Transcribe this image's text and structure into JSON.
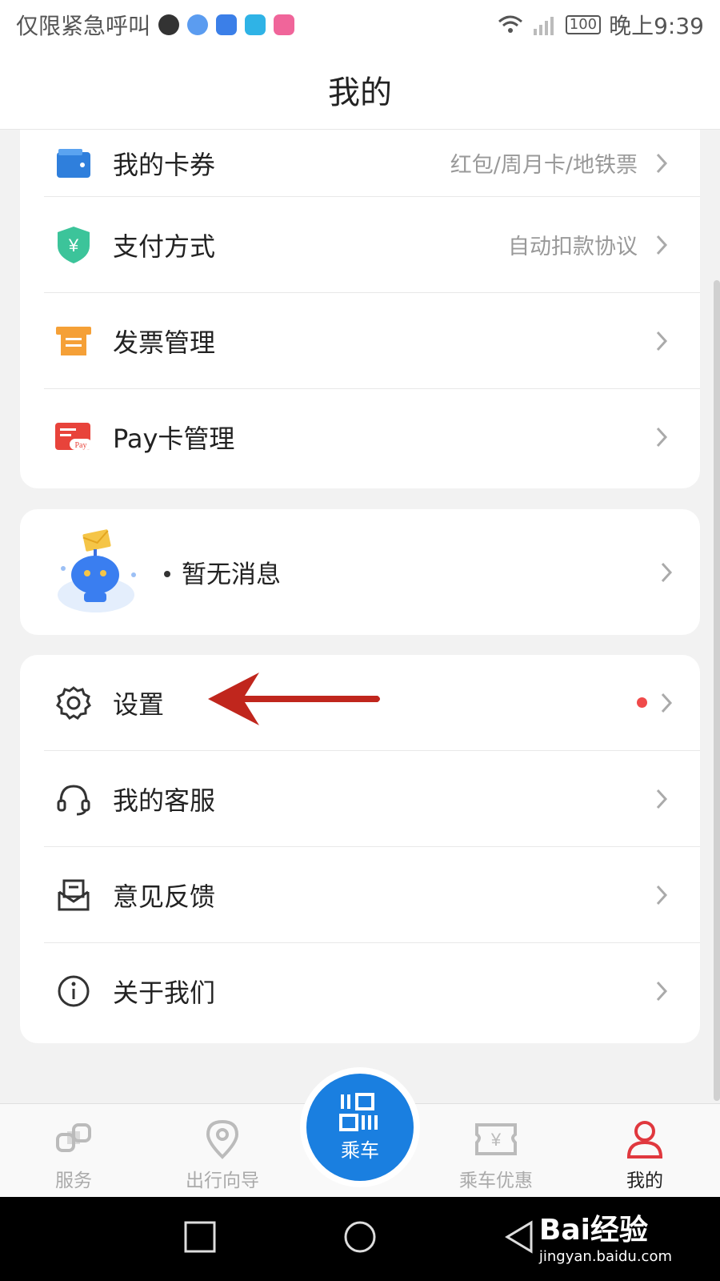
{
  "status_bar": {
    "carrier_text": "仅限紧急呼叫",
    "battery": "100",
    "time": "晚上9:39"
  },
  "header": {
    "title": "我的"
  },
  "wallet_section": {
    "items": [
      {
        "label": "我的卡券",
        "sub": "红包/周月卡/地铁票",
        "icon": "wallet-icon"
      },
      {
        "label": "支付方式",
        "sub": "自动扣款协议",
        "icon": "yuan-shield-icon"
      },
      {
        "label": "发票管理",
        "sub": "",
        "icon": "invoice-icon"
      },
      {
        "label": "Pay卡管理",
        "sub": "",
        "icon": "pay-card-icon"
      }
    ]
  },
  "messages": {
    "text": "暂无消息"
  },
  "settings_section": {
    "items": [
      {
        "label": "设置",
        "icon": "gear-icon",
        "badge": true
      },
      {
        "label": "我的客服",
        "icon": "headset-icon"
      },
      {
        "label": "意见反馈",
        "icon": "feedback-icon"
      },
      {
        "label": "关于我们",
        "icon": "info-icon"
      }
    ]
  },
  "tabbar": {
    "tabs": [
      {
        "label": "服务"
      },
      {
        "label": "出行向导"
      },
      {
        "label": "乘车"
      },
      {
        "label": "乘车优惠"
      },
      {
        "label": "我的"
      }
    ]
  },
  "watermark": {
    "brand": "Bai经验",
    "url": "jingyan.baidu.com"
  },
  "colors": {
    "accent": "#1a7fe0",
    "active_tab": "#e0383e",
    "badge": "#f04a4a",
    "annotation": "#c0261d"
  }
}
